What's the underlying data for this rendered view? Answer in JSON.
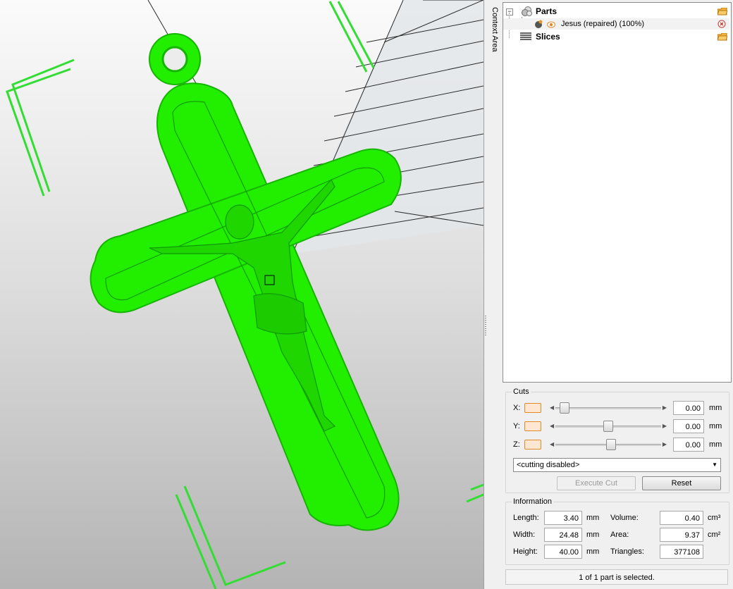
{
  "viewport": {
    "model_color": "#22ee00",
    "frame_color": "#33dd33"
  },
  "side_label": "Context Area",
  "tree": {
    "parts": {
      "label": "Parts",
      "icon": "parts-icon",
      "action_icon": "folder-open-icon"
    },
    "part_item": {
      "label": "Jesus (repaired) (100%)",
      "icon": "model-part-icon",
      "visibility_icon": "eye-icon",
      "remove_icon": "remove-icon"
    },
    "slices": {
      "label": "Slices",
      "icon": "slices-icon",
      "action_icon": "folder-open-icon"
    }
  },
  "cuts": {
    "title": "Cuts",
    "rows": [
      {
        "axis": "X:",
        "value": "0.00",
        "unit": "mm",
        "position": 0.05
      },
      {
        "axis": "Y:",
        "value": "0.00",
        "unit": "mm",
        "position": 0.5
      },
      {
        "axis": "Z:",
        "value": "0.00",
        "unit": "mm",
        "position": 0.52
      }
    ],
    "mode": "<cutting disabled>",
    "execute_label": "Execute Cut",
    "reset_label": "Reset"
  },
  "information": {
    "title": "Information",
    "length_label": "Length:",
    "length_value": "3.40",
    "length_unit": "mm",
    "width_label": "Width:",
    "width_value": "24.48",
    "width_unit": "mm",
    "height_label": "Height:",
    "height_value": "40.00",
    "height_unit": "mm",
    "volume_label": "Volume:",
    "volume_value": "0.40",
    "volume_unit": "cm³",
    "area_label": "Area:",
    "area_value": "9.37",
    "area_unit": "cm²",
    "triangles_label": "Triangles:",
    "triangles_value": "377108"
  },
  "status": "1 of 1 part is selected."
}
